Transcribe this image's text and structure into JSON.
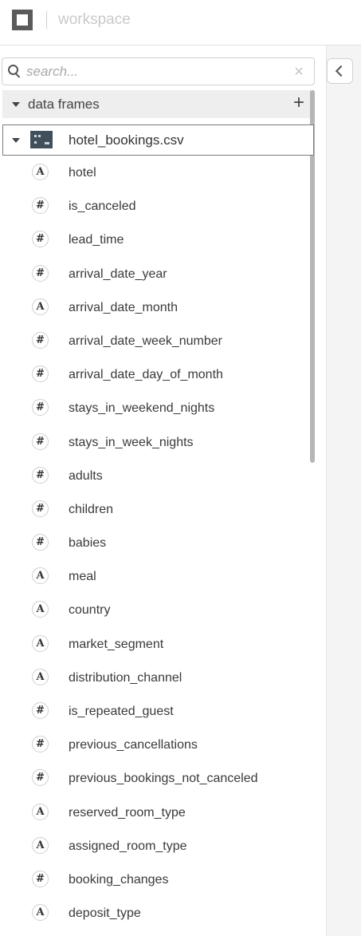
{
  "header": {
    "title": "workspace",
    "logo_icon": "square-logo-icon"
  },
  "search": {
    "placeholder": "search...",
    "value": "",
    "clear_symbol": "×"
  },
  "collapse_button": {
    "icon": "chevron-left-icon"
  },
  "section": {
    "label": "data frames",
    "add_symbol": "+"
  },
  "file": {
    "name": "hotel_bookings.csv",
    "icon": "dataframe-icon"
  },
  "type_symbols": {
    "text": "A",
    "number": "#"
  },
  "columns": [
    {
      "name": "hotel",
      "type": "text"
    },
    {
      "name": "is_canceled",
      "type": "number"
    },
    {
      "name": "lead_time",
      "type": "number"
    },
    {
      "name": "arrival_date_year",
      "type": "number"
    },
    {
      "name": "arrival_date_month",
      "type": "text"
    },
    {
      "name": "arrival_date_week_number",
      "type": "number"
    },
    {
      "name": "arrival_date_day_of_month",
      "type": "number"
    },
    {
      "name": "stays_in_weekend_nights",
      "type": "number"
    },
    {
      "name": "stays_in_week_nights",
      "type": "number"
    },
    {
      "name": "adults",
      "type": "number"
    },
    {
      "name": "children",
      "type": "number"
    },
    {
      "name": "babies",
      "type": "number"
    },
    {
      "name": "meal",
      "type": "text"
    },
    {
      "name": "country",
      "type": "text"
    },
    {
      "name": "market_segment",
      "type": "text"
    },
    {
      "name": "distribution_channel",
      "type": "text"
    },
    {
      "name": "is_repeated_guest",
      "type": "number"
    },
    {
      "name": "previous_cancellations",
      "type": "number"
    },
    {
      "name": "previous_bookings_not_canceled",
      "type": "number"
    },
    {
      "name": "reserved_room_type",
      "type": "text"
    },
    {
      "name": "assigned_room_type",
      "type": "text"
    },
    {
      "name": "booking_changes",
      "type": "number"
    },
    {
      "name": "deposit_type",
      "type": "text"
    }
  ]
}
